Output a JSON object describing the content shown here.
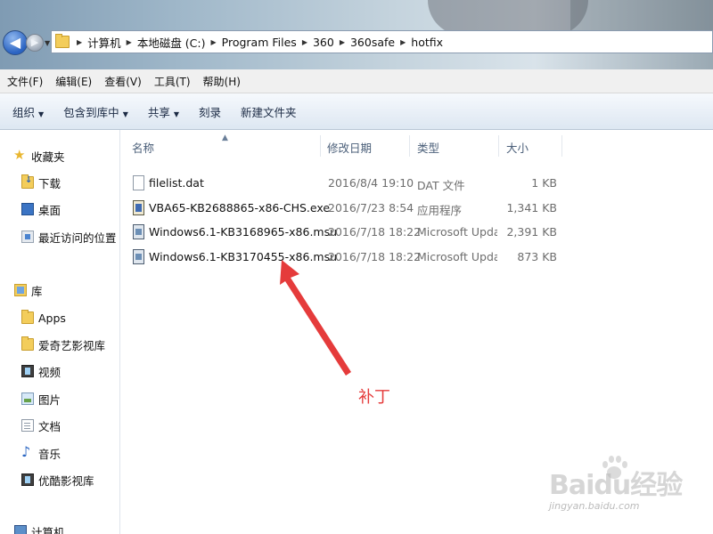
{
  "address_bar": {
    "breadcrumbs": [
      "计算机",
      "本地磁盘 (C:)",
      "Program Files",
      "360",
      "360safe",
      "hotfix"
    ]
  },
  "menubar": {
    "items": [
      "文件(F)",
      "编辑(E)",
      "查看(V)",
      "工具(T)",
      "帮助(H)"
    ]
  },
  "toolbar": {
    "organize": "组织",
    "include_in_library": "包含到库中",
    "share": "共享",
    "burn": "刻录",
    "new_folder": "新建文件夹"
  },
  "navigation": {
    "favorites": {
      "label": "收藏夹",
      "items": [
        "下载",
        "桌面",
        "最近访问的位置"
      ]
    },
    "libraries": {
      "label": "库",
      "items": [
        "Apps",
        "爱奇艺影视库",
        "视频",
        "图片",
        "文档",
        "音乐",
        "优酷影视库"
      ]
    },
    "computer": {
      "label": "计算机"
    }
  },
  "columns": {
    "name": "名称",
    "date": "修改日期",
    "type": "类型",
    "size": "大小"
  },
  "files": [
    {
      "name": "filelist.dat",
      "date": "2016/8/4 19:10",
      "type": "DAT 文件",
      "size": "1 KB",
      "icon": "dat-file-icon"
    },
    {
      "name": "VBA65-KB2688865-x86-CHS.exe",
      "date": "2016/7/23 8:54",
      "type": "应用程序",
      "size": "1,341 KB",
      "icon": "exe-file-icon"
    },
    {
      "name": "Windows6.1-KB3168965-x86.msu",
      "date": "2016/7/18 18:22",
      "type": "Microsoft Updat...",
      "size": "2,391 KB",
      "icon": "msu-file-icon"
    },
    {
      "name": "Windows6.1-KB3170455-x86.msu",
      "date": "2016/7/18 18:22",
      "type": "Microsoft Updat...",
      "size": "873 KB",
      "icon": "msu-file-icon"
    }
  ],
  "annotation": {
    "label": "补丁",
    "color": "#e53b3b"
  },
  "watermark": {
    "logo_text": "Baidu经验",
    "url": "jingyan.baidu.com"
  }
}
